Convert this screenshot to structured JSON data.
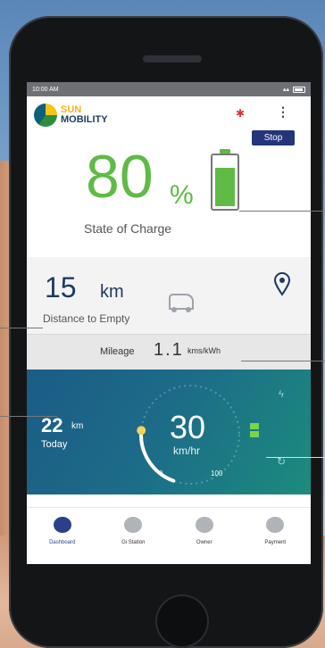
{
  "status_bar": {
    "time": "10:00 AM",
    "signal_text": ""
  },
  "header": {
    "logo_line1": "SUN",
    "logo_line2": "MOBILITY",
    "bluetooth_icon": "bluetooth-icon",
    "menu_icon": "more-vertical-icon",
    "stop_label": "Stop"
  },
  "charge": {
    "value": "80",
    "unit": "%",
    "label": "State of Charge",
    "level_fraction": 0.8,
    "color": "#5fbb45"
  },
  "distance": {
    "value": "15",
    "unit": "km",
    "label": "Distance to Empty",
    "vehicle_icon": "auto-rickshaw-icon",
    "location_icon": "location-pin-icon"
  },
  "mileage": {
    "label": "Mileage",
    "value": "1.1",
    "unit": "kms/kWh"
  },
  "trip": {
    "value": "22",
    "unit": "km",
    "label": "Today"
  },
  "speed": {
    "value": "30",
    "unit": "km/hr",
    "min": "0",
    "max": "100",
    "fraction": 0.3
  },
  "nav": [
    {
      "label": "Dashboard",
      "icon": "dashboard-icon",
      "active": true
    },
    {
      "label": "Gi Station",
      "icon": "station-icon",
      "active": false
    },
    {
      "label": "Owner",
      "icon": "owner-icon",
      "active": false
    },
    {
      "label": "Payment",
      "icon": "payment-icon",
      "active": false
    }
  ],
  "colors": {
    "accent_green": "#5fbb45",
    "brand_navy": "#24357a",
    "speed_panel": "#1c6b88"
  }
}
